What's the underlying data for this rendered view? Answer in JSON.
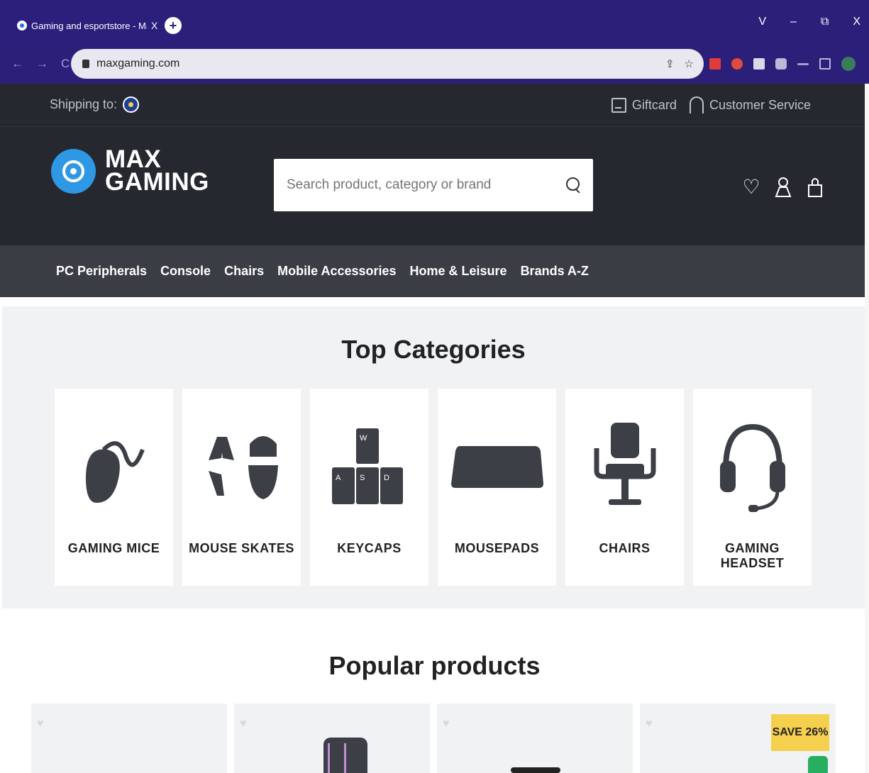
{
  "browser": {
    "tab_title": "Gaming and esportstore - MaxGa",
    "tab_close": "X",
    "new_tab": "+",
    "url": "maxgaming.com",
    "window_controls": [
      "V",
      "–",
      "⧉",
      "X"
    ]
  },
  "topbar": {
    "shipping_label": "Shipping to:",
    "giftcard": "Giftcard",
    "customer_service": "Customer Service"
  },
  "header": {
    "logo_line1": "MAX",
    "logo_line2": "GAMING",
    "search_placeholder": "Search product, category or brand"
  },
  "nav": {
    "items": [
      "PC Peripherals",
      "Console",
      "Chairs",
      "Mobile Accessories",
      "Home & Leisure",
      "Brands A-Z"
    ]
  },
  "top_categories": {
    "title": "Top Categories",
    "cards": [
      {
        "label": "GAMING MICE",
        "icon": "mouse-icon"
      },
      {
        "label": "MOUSE SKATES",
        "icon": "mouse-skates-icon"
      },
      {
        "label": "KEYCAPS",
        "icon": "keycaps-icon"
      },
      {
        "label": "MOUSEPADS",
        "icon": "mousepad-icon"
      },
      {
        "label": "CHAIRS",
        "icon": "chair-icon"
      },
      {
        "label": "GAMING HEADSET",
        "icon": "headset-icon"
      }
    ],
    "keycap_letters": [
      "W",
      "A",
      "S",
      "D"
    ]
  },
  "popular": {
    "title": "Popular products",
    "save_badge": "SAVE 26%"
  },
  "colors": {
    "header_bg": "#25282e",
    "nav_bg": "#3a3d44",
    "accent_blue": "#2f98e4",
    "badge_yellow": "#f5d04f"
  }
}
